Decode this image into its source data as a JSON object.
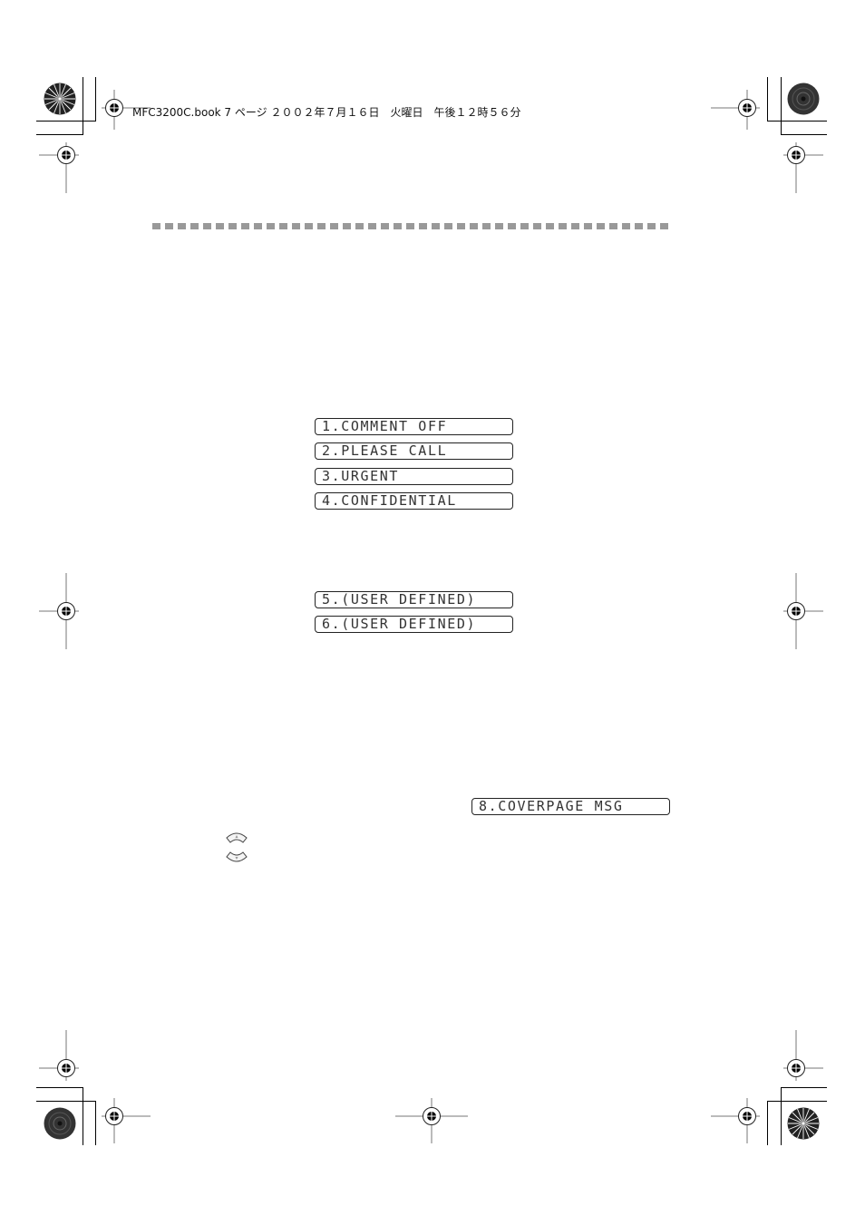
{
  "header": {
    "text": "MFC3200C.book 7 ページ ２００２年７月１６日　火曜日　午後１２時５６分"
  },
  "lcd_displays": {
    "group1": [
      "1.COMMENT OFF",
      "2.PLEASE CALL",
      "3.URGENT",
      "4.CONFIDENTIAL"
    ],
    "group2": [
      "5.(USER DEFINED)",
      "6.(USER DEFINED)"
    ],
    "coverpage": "8.COVERPAGE MSG"
  },
  "icons": {
    "nav_up": "up-arrow-key-icon",
    "nav_down": "down-arrow-key-icon",
    "registration": "crosshair-registration-icon",
    "color_target": "starburst-target-icon"
  },
  "colors": {
    "dash": "#999999",
    "lcd_border": "#222222",
    "lcd_text": "#333333"
  }
}
